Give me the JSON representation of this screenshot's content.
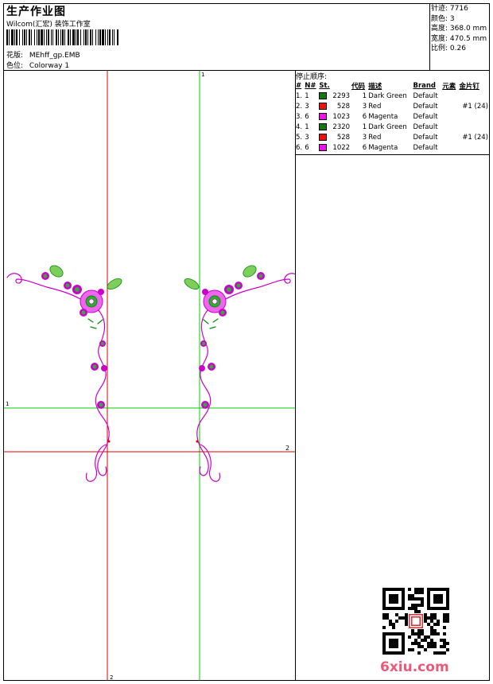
{
  "header": {
    "title": "生产作业图",
    "subtitle": "Wilcom(汇宏) 装饰工作室",
    "design_label": "花版:",
    "design_value": "MEhff_gp.EMB",
    "color_label": "色位:",
    "color_value": "Colorway 1"
  },
  "specs": [
    {
      "label": "针迹:",
      "value": "7716"
    },
    {
      "label": "颜色:",
      "value": "3"
    },
    {
      "label": "高度:",
      "value": "368.0 mm"
    },
    {
      "label": "宽度:",
      "value": "470.5 mm"
    },
    {
      "label": "比例:",
      "value": "0.26"
    }
  ],
  "stop_sequence": {
    "title": "停止顺序:",
    "headers": [
      "#",
      "N#",
      "St.",
      "代码",
      "描述",
      "Brand",
      "元素",
      "金片钉"
    ],
    "rows": [
      {
        "num": "1.",
        "n": "1",
        "color": "#0f7a0f",
        "st": "2293",
        "code": "1",
        "desc": "Dark Green",
        "brand": "Default",
        "elem": "",
        "seq": ""
      },
      {
        "num": "2.",
        "n": "3",
        "color": "#ee1111",
        "st": "528",
        "code": "3",
        "desc": "Red",
        "brand": "Default",
        "elem": "",
        "seq": "#1 (24)"
      },
      {
        "num": "3.",
        "n": "6",
        "color": "#ee11ee",
        "st": "1023",
        "code": "6",
        "desc": "Magenta",
        "brand": "Default",
        "elem": "",
        "seq": ""
      },
      {
        "num": "4.",
        "n": "1",
        "color": "#0f7a0f",
        "st": "2320",
        "code": "1",
        "desc": "Dark Green",
        "brand": "Default",
        "elem": "",
        "seq": ""
      },
      {
        "num": "5.",
        "n": "3",
        "color": "#ee1111",
        "st": "528",
        "code": "3",
        "desc": "Red",
        "brand": "Default",
        "elem": "",
        "seq": "#1 (24)"
      },
      {
        "num": "6.",
        "n": "6",
        "color": "#ee11ee",
        "st": "1022",
        "code": "6",
        "desc": "Magenta",
        "brand": "Default",
        "elem": "",
        "seq": ""
      }
    ]
  },
  "canvas": {
    "guide_labels": {
      "green_v": "1",
      "green_h": "1",
      "red_h": "2",
      "red_v": "2"
    },
    "colors": {
      "red_guide": "#e00000",
      "green_guide": "#00cc00",
      "stitch_magenta": "#cc00cc",
      "stitch_green": "#0a8a0a",
      "stitch_red": "#dd0000"
    }
  },
  "watermark": "6xiu.com"
}
